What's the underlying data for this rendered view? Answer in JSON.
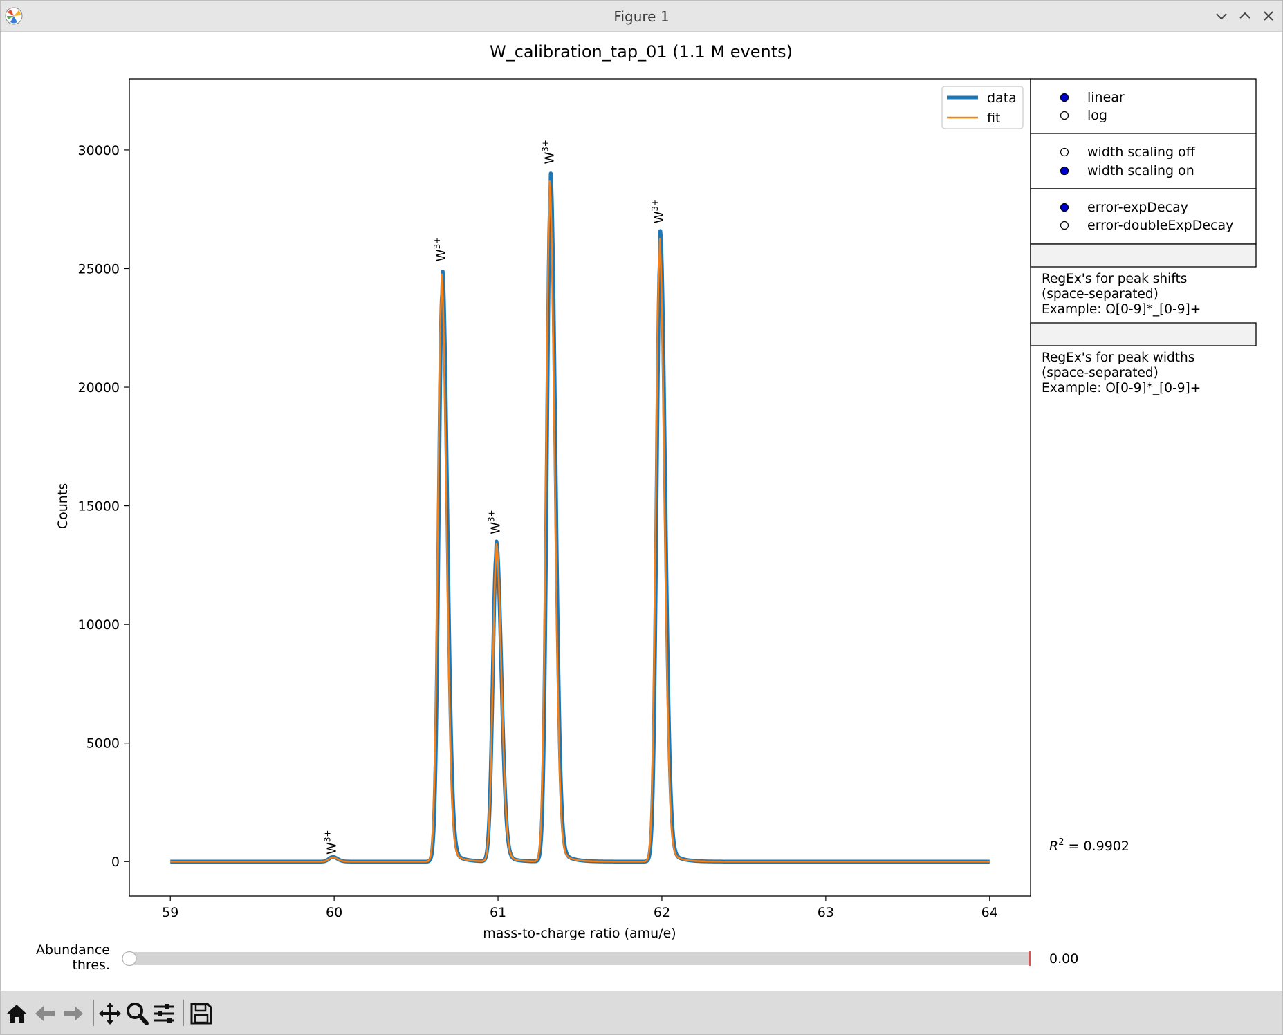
{
  "window": {
    "title": "Figure 1"
  },
  "figure": {
    "title": "W_calibration_tap_01 (1.1 M events)",
    "r2_label": "R",
    "r2_sup": "2",
    "r2_value": " = 0.9902"
  },
  "chart_data": {
    "type": "line",
    "xlabel": "mass-to-charge ratio (amu/e)",
    "ylabel": "Counts",
    "xlim": [
      58.75,
      64.25
    ],
    "ylim": [
      -1450,
      33000
    ],
    "xticks": [
      59,
      60,
      61,
      62,
      63,
      64
    ],
    "yticks": [
      0,
      5000,
      10000,
      15000,
      20000,
      25000,
      30000
    ],
    "grid": false,
    "legend_position": "top-right",
    "series": [
      {
        "name": "data",
        "color": "#1f77b4",
        "baseline": 0,
        "peaks": [
          {
            "x": 59.99,
            "height": 200
          },
          {
            "x": 60.66,
            "height": 25000
          },
          {
            "x": 60.99,
            "height": 13500
          },
          {
            "x": 61.32,
            "height": 29100
          },
          {
            "x": 61.99,
            "height": 26600
          }
        ]
      },
      {
        "name": "fit",
        "color": "#ff7f0e",
        "baseline": 0,
        "peaks": [
          {
            "x": 59.99,
            "height": 180
          },
          {
            "x": 60.655,
            "height": 24800
          },
          {
            "x": 60.99,
            "height": 13400
          },
          {
            "x": 61.315,
            "height": 28700
          },
          {
            "x": 61.985,
            "height": 26400
          }
        ]
      }
    ],
    "x_range": [
      59.0,
      64.0
    ],
    "peak_labels": [
      {
        "x": 59.98,
        "y": 300,
        "base": "W",
        "sup": "3+"
      },
      {
        "x": 60.65,
        "y": 25300,
        "base": "W",
        "sup": "3+"
      },
      {
        "x": 60.98,
        "y": 13800,
        "base": "W",
        "sup": "3+"
      },
      {
        "x": 61.31,
        "y": 29400,
        "base": "W",
        "sup": "3+"
      },
      {
        "x": 61.98,
        "y": 26900,
        "base": "W",
        "sup": "3+"
      }
    ]
  },
  "controls": {
    "scale_radio": {
      "options": [
        "linear",
        "log"
      ],
      "selected": 0
    },
    "width_radio": {
      "options": [
        "width scaling off",
        "width scaling on"
      ],
      "selected": 1
    },
    "error_radio": {
      "options": [
        "error-expDecay",
        "error-doubleExpDecay"
      ],
      "selected": 0
    },
    "shift_regex": {
      "value": "",
      "help": [
        "RegEx's for peak shifts",
        "(space-separated)",
        "Example: O[0-9]*_[0-9]+"
      ]
    },
    "width_regex": {
      "value": "",
      "help": [
        "RegEx's for peak widths",
        "(space-separated)",
        "Example: O[0-9]*_[0-9]+"
      ]
    },
    "slider": {
      "label_line1": "Abundance",
      "label_line2": "thres.",
      "value_text": "0.00",
      "fraction": 0.0
    }
  },
  "toolbar": {
    "buttons": [
      "home-icon",
      "back-icon",
      "forward-icon",
      "pan-icon",
      "zoom-icon",
      "configure-subplots-icon",
      "save-icon"
    ]
  },
  "colors": {
    "radio_selected": "#0000cc",
    "textbox_bg": "#f2f2f2",
    "slider_track": "#d3d3d3",
    "slider_max_marker": "#d62728"
  }
}
